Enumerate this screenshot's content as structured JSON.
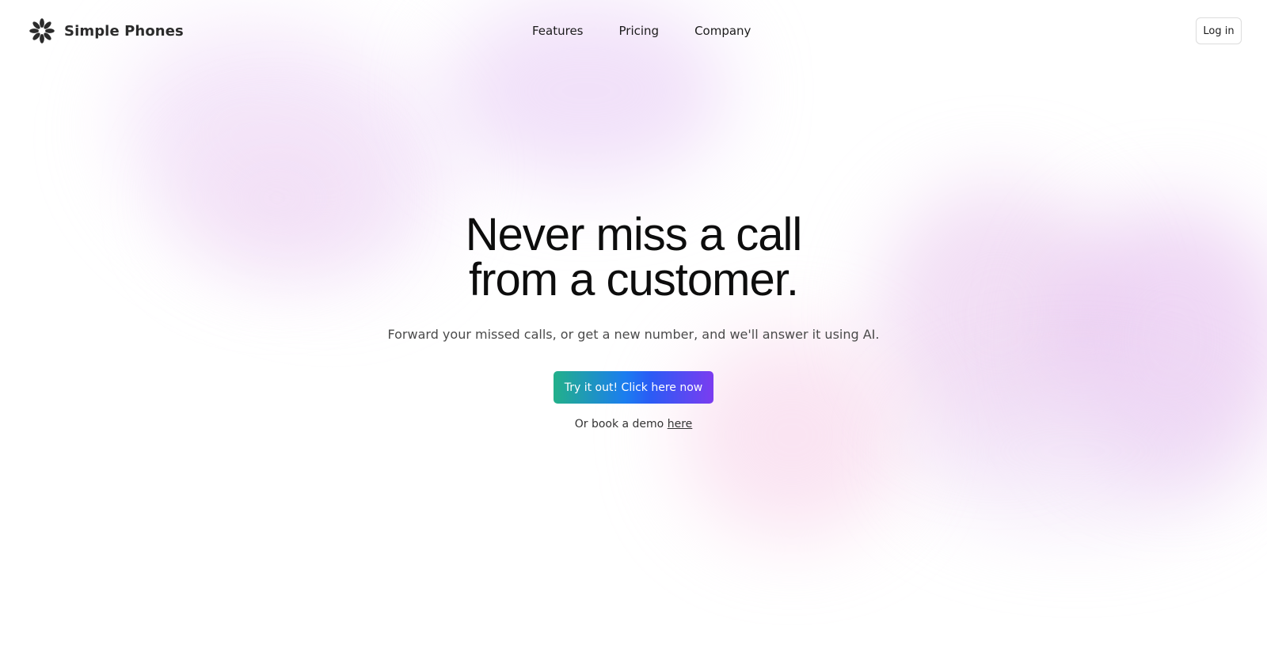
{
  "brand": {
    "name": "Simple Phones",
    "logo_icon": "flower-burst-icon"
  },
  "nav": {
    "items": [
      {
        "label": "Features"
      },
      {
        "label": "Pricing"
      },
      {
        "label": "Company"
      }
    ]
  },
  "header": {
    "login_label": "Log in"
  },
  "hero": {
    "title_line1": "Never miss a call",
    "title_line2": "from a customer.",
    "subtitle": "Forward your missed calls, or get a new number, and we'll answer it using AI.",
    "cta_label": "Try it out! Click here now",
    "demo_prefix": "Or book a demo",
    "demo_link": "here"
  },
  "colors": {
    "cta_gradient": [
      "#22b08a",
      "#1b7df0",
      "#7b3cf0"
    ],
    "background_blob": "#e8cdf5"
  }
}
